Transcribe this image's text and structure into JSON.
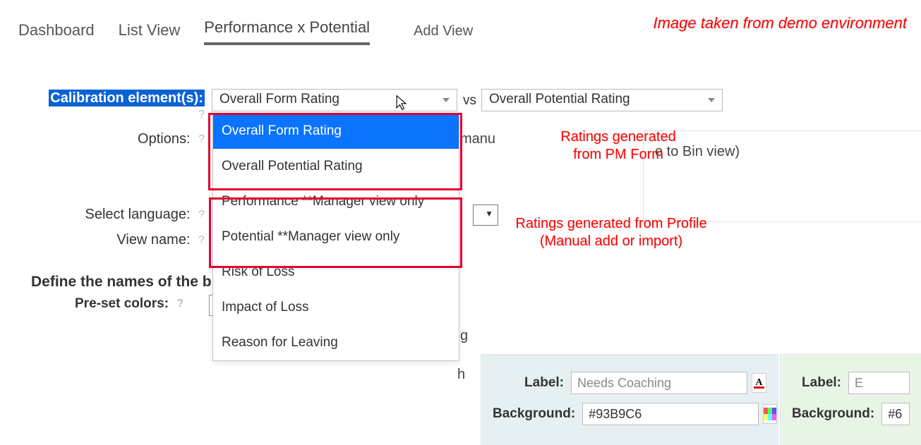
{
  "demo_note": "Image taken from demo environment",
  "tabs": {
    "dashboard": "Dashboard",
    "list_view": "List View",
    "perf_pot": "Performance x Potential",
    "add_view": "Add View"
  },
  "labels": {
    "calibration": "Calibration element(s):",
    "options": "Options:",
    "select_language": "Select language:",
    "view_name": "View name:",
    "define_bins": "Define the names of the b",
    "preset_colors": "Pre-set colors:",
    "vs": "vs"
  },
  "select1": {
    "value": "Overall Form Rating"
  },
  "select2": {
    "value": "Overall Potential Rating"
  },
  "dropdown_options": [
    "Overall Form Rating",
    "Overall Potential Rating",
    "Performance **Manager view only",
    "Potential **Manager view only",
    "Risk of Loss",
    "Impact of Loss",
    "Reason for Leaving"
  ],
  "options_text": {
    "left_fragment": "",
    "right_tail": "e to Bin view)",
    "manu": "manu"
  },
  "fragments": {
    "g": "g",
    "h": "h"
  },
  "annotations": {
    "pm_form": "Ratings generated\nfrom PM Form",
    "profile": "Ratings generated from Profile\n(Manual add or import)"
  },
  "bins": {
    "b1": {
      "label_label": "Label:",
      "label_value": "Needs Coaching",
      "bg_label": "Background:",
      "bg_value": "#93B9C6"
    },
    "b2": {
      "label_label": "Label:",
      "label_value": "E",
      "bg_label": "Background:",
      "bg_value": "#6"
    }
  }
}
